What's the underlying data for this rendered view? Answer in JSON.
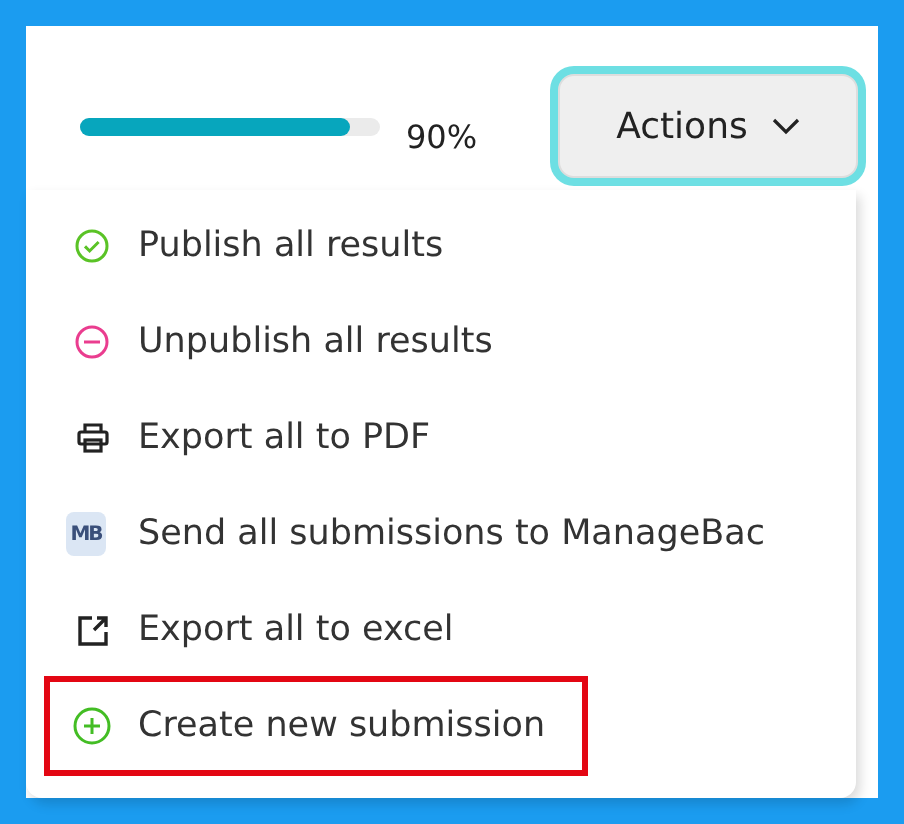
{
  "progress": {
    "level": 0.9,
    "reading": "90%"
  },
  "actions_button": {
    "label": "Actions",
    "focused": true
  },
  "menu": {
    "items": [
      {
        "kind": "check",
        "label": "Publish all results",
        "highlighted": false
      },
      {
        "kind": "minus",
        "label": "Unpublish all results",
        "highlighted": false
      },
      {
        "kind": "print",
        "label": "Export all to PDF",
        "highlighted": false
      },
      {
        "kind": "logo",
        "logo_text": "MB",
        "label": "Send all submissions to ManageBac",
        "highlighted": false
      },
      {
        "kind": "export",
        "label": "Export all to excel",
        "highlighted": false
      },
      {
        "kind": "plus",
        "label": "Create new submission",
        "highlighted": true
      }
    ]
  }
}
